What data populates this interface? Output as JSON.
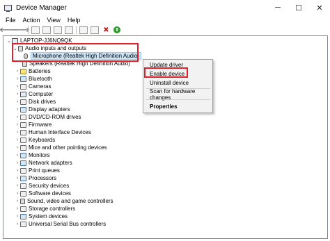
{
  "window": {
    "title": "Device Manager",
    "min": "─",
    "max": "☐",
    "close": "✕"
  },
  "menu": [
    "File",
    "Action",
    "View",
    "Help"
  ],
  "toolbar": {
    "back": "🡐",
    "forward": "🡒",
    "uninstall": "✖",
    "enable": "⬆"
  },
  "colors": {
    "highlight_box": "#e3202a",
    "selection": "#cce4f7",
    "uninstall_red": "#cc1f1f",
    "enable_green": "#2a9d2a"
  },
  "tree": {
    "root": "LAPTOP-JJ6NQ9QK",
    "audio": {
      "label": "Audio inputs and outputs",
      "children": [
        "Microphone (Realtek High Definition Audio)",
        "Speakers (Realtek High Definition Audio)"
      ]
    },
    "categories": [
      "Batteries",
      "Bluetooth",
      "Cameras",
      "Computer",
      "Disk drives",
      "Display adapters",
      "DVD/CD-ROM drives",
      "Firmware",
      "Human Interface Devices",
      "Keyboards",
      "Mice and other pointing devices",
      "Monitors",
      "Network adapters",
      "Print queues",
      "Processors",
      "Security devices",
      "Software devices",
      "Sound, video and game controllers",
      "Storage controllers",
      "System devices",
      "Universal Serial Bus controllers"
    ]
  },
  "context_menu": {
    "update": "Update driver",
    "enable": "Enable device",
    "uninstall": "Uninstall device",
    "scan": "Scan for hardware changes",
    "properties": "Properties"
  }
}
